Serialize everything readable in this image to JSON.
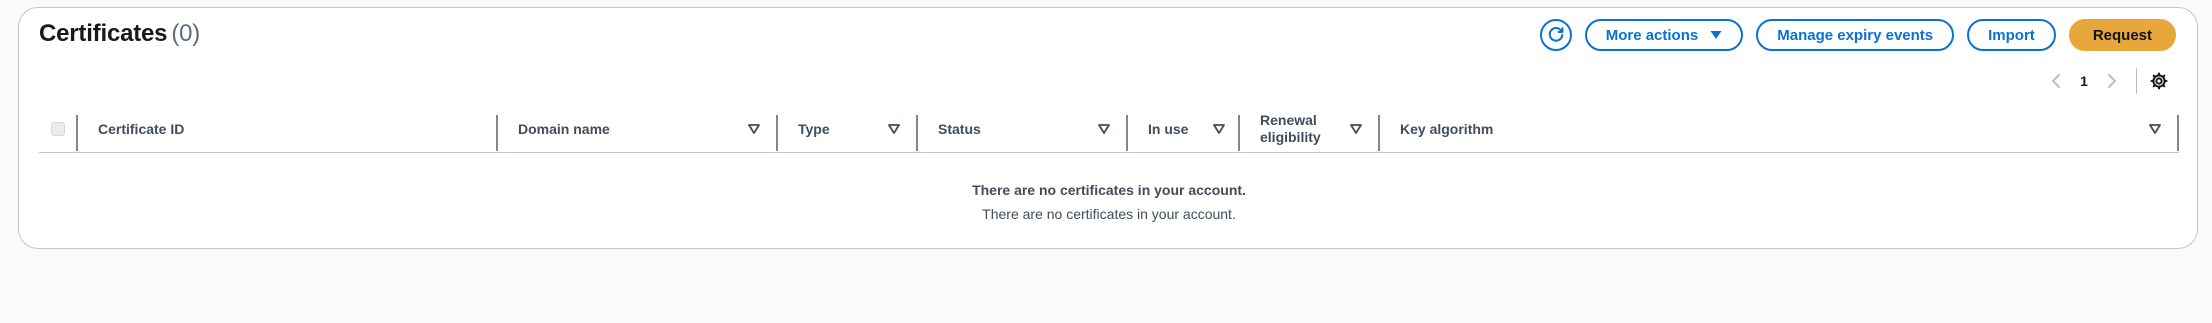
{
  "header": {
    "title": "Certificates",
    "count": "(0)"
  },
  "actions": {
    "refresh_icon": "refresh-icon",
    "more_actions_label": "More actions",
    "manage_expiry_label": "Manage expiry events",
    "import_label": "Import",
    "request_label": "Request"
  },
  "pagination": {
    "current_page": "1"
  },
  "table": {
    "columns": [
      {
        "label": "Certificate ID"
      },
      {
        "label": "Domain name"
      },
      {
        "label": "Type"
      },
      {
        "label": "Status"
      },
      {
        "label": "In use"
      },
      {
        "label": "Renewal eligibility"
      },
      {
        "label": "Key algorithm"
      }
    ],
    "empty_title": "There are no certificates in your account.",
    "empty_description": "There are no certificates in your account."
  },
  "colors": {
    "accent": "#0972d3",
    "primary_button": "#e8a73a",
    "border": "#c6c6cd"
  }
}
